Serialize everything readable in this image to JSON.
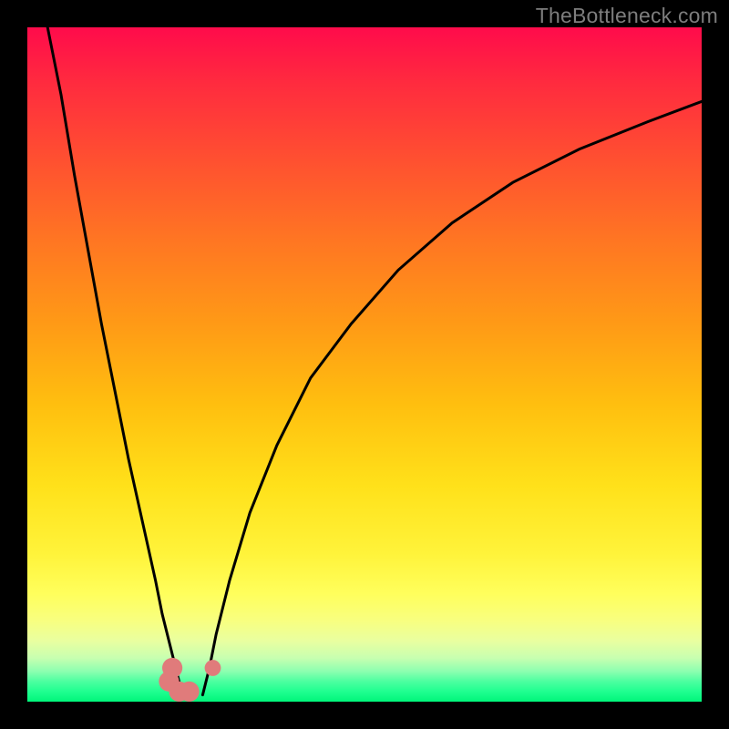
{
  "watermark": {
    "text": "TheBottleneck.com"
  },
  "gradient": {
    "stops": [
      {
        "pos": 0.0,
        "color": "#ff0b4b"
      },
      {
        "pos": 0.08,
        "color": "#ff2a3f"
      },
      {
        "pos": 0.2,
        "color": "#ff5130"
      },
      {
        "pos": 0.32,
        "color": "#ff7722"
      },
      {
        "pos": 0.44,
        "color": "#ff9a16"
      },
      {
        "pos": 0.56,
        "color": "#ffbf0f"
      },
      {
        "pos": 0.68,
        "color": "#ffe11a"
      },
      {
        "pos": 0.78,
        "color": "#fff33a"
      },
      {
        "pos": 0.84,
        "color": "#ffff5c"
      },
      {
        "pos": 0.88,
        "color": "#f8ff80"
      },
      {
        "pos": 0.91,
        "color": "#e9ffa0"
      },
      {
        "pos": 0.935,
        "color": "#c8ffb0"
      },
      {
        "pos": 0.955,
        "color": "#8cffb0"
      },
      {
        "pos": 0.97,
        "color": "#4cffa0"
      },
      {
        "pos": 0.985,
        "color": "#1fff90"
      },
      {
        "pos": 1.0,
        "color": "#00f57a"
      }
    ]
  },
  "chart_data": {
    "type": "line",
    "title": "",
    "xlabel": "",
    "ylabel": "",
    "xlim": [
      0,
      100
    ],
    "ylim": [
      0,
      100
    ],
    "note": "Vertical-gradient heat plot with two black V-shaped curves descending to near-zero around x≈23–26. Red cluster markers near the valley. Values read approximately from pixel positions; chart has no axis labels or ticks.",
    "series": [
      {
        "name": "left-curve",
        "x": [
          3,
          5,
          7,
          9,
          11,
          13,
          15,
          17,
          19,
          20,
          21,
          22,
          23
        ],
        "y": [
          100,
          90,
          78,
          67,
          56,
          46,
          36,
          27,
          18,
          13,
          9,
          5,
          1
        ]
      },
      {
        "name": "right-curve",
        "x": [
          26,
          27,
          28,
          30,
          33,
          37,
          42,
          48,
          55,
          63,
          72,
          82,
          92,
          100
        ],
        "y": [
          1,
          5,
          10,
          18,
          28,
          38,
          48,
          56,
          64,
          71,
          77,
          82,
          86,
          89
        ]
      }
    ],
    "markers": [
      {
        "name": "valley-cluster-l1",
        "x": 21.5,
        "y": 5.0,
        "r": 1.5,
        "color": "#e07b7b"
      },
      {
        "name": "valley-cluster-l2",
        "x": 21.0,
        "y": 3.0,
        "r": 1.5,
        "color": "#e07b7b"
      },
      {
        "name": "valley-cluster-l3",
        "x": 22.5,
        "y": 1.5,
        "r": 1.5,
        "color": "#e07b7b"
      },
      {
        "name": "valley-cluster-l4",
        "x": 24.0,
        "y": 1.5,
        "r": 1.5,
        "color": "#e07b7b"
      },
      {
        "name": "valley-dot-right",
        "x": 27.5,
        "y": 5.0,
        "r": 1.2,
        "color": "#e07b7b"
      }
    ]
  }
}
